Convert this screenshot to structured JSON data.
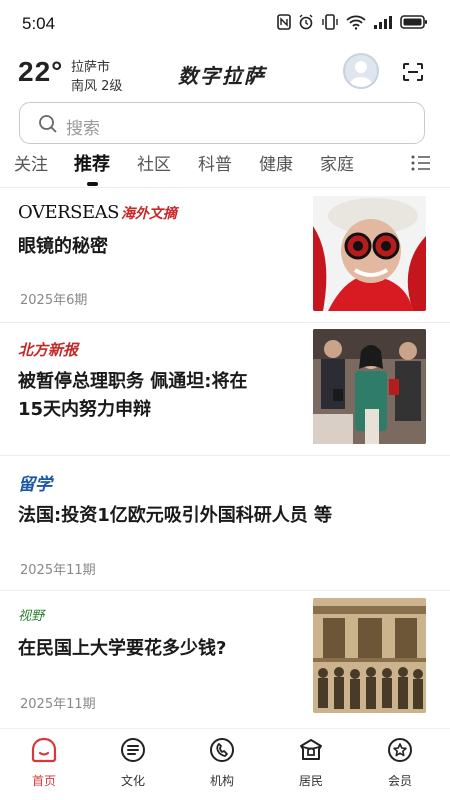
{
  "status_bar": {
    "time": "5:04"
  },
  "header": {
    "temperature": "22°",
    "city": "拉萨市",
    "wind": "南风  2级",
    "app_title": "数字拉萨"
  },
  "search": {
    "placeholder": "搜索"
  },
  "tabs": [
    {
      "label": "关注"
    },
    {
      "label": "推荐",
      "active": true
    },
    {
      "label": "社区"
    },
    {
      "label": "科普"
    },
    {
      "label": "健康"
    },
    {
      "label": "家庭"
    }
  ],
  "feed": [
    {
      "publication": "OVERSEAS 海外文摘",
      "publication_latin": "OVERSEAS",
      "publication_cn": "海外文摘",
      "title": "眼镜的秘密",
      "date": "2025年6期",
      "has_thumbnail": true
    },
    {
      "publication": "北方新报",
      "title_line1": "被暂停总理职务  佩通坦:将在",
      "title_line2": "15天内努力申辩",
      "date": "",
      "has_thumbnail": true
    },
    {
      "publication": "留学",
      "title": "法国:投资1亿欧元吸引外国科研人员 等",
      "date": "2025年11期",
      "has_thumbnail": false
    },
    {
      "publication": "视野",
      "title": "在民国上大学要花多少钱?",
      "date": "2025年11期",
      "has_thumbnail": true
    }
  ],
  "bottom_nav": [
    {
      "label": "首页",
      "icon": "home-icon",
      "active": true
    },
    {
      "label": "文化",
      "icon": "culture-icon"
    },
    {
      "label": "机构",
      "icon": "institution-icon"
    },
    {
      "label": "居民",
      "icon": "resident-icon"
    },
    {
      "label": "会员",
      "icon": "member-icon"
    }
  ],
  "colors": {
    "accent": "#d6383a",
    "text": "#1a1a1a",
    "muted": "#888888"
  }
}
